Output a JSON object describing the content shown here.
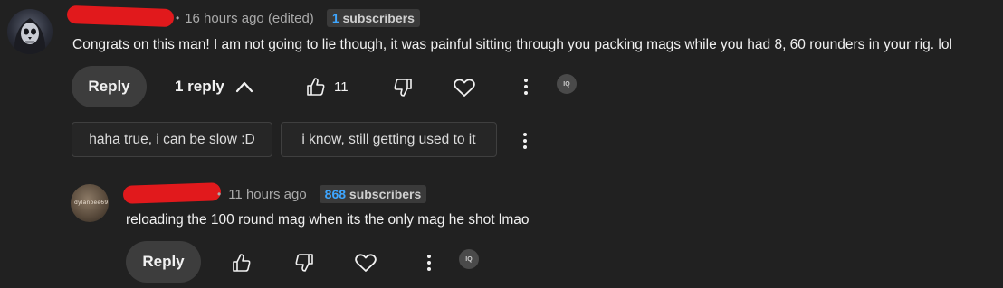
{
  "comment": {
    "avatar_icon": "skull-hooded-avatar-icon",
    "timestamp": "16 hours ago (edited)",
    "subscriber_count": "1",
    "subscriber_label": "subscribers",
    "text": "Congrats on this man! I am not going to lie though, it was painful sitting through you packing mags while you had 8, 60 rounders in your rig. lol",
    "actions": {
      "reply_label": "Reply",
      "replies_label": "1 reply",
      "like_count": "11"
    },
    "suggestions": [
      "haha true, i can be slow :D",
      "i know, still getting used to it"
    ],
    "extension_badge": "IQ"
  },
  "reply": {
    "avatar_text": "dylanbee69",
    "timestamp": "11 hours ago",
    "subscriber_count": "868",
    "subscriber_label": "subscribers",
    "text": "reloading the 100 round mag when its the only mag he shot lmao",
    "actions": {
      "reply_label": "Reply"
    },
    "extension_badge": "IQ"
  },
  "colors": {
    "background": "#212121",
    "redaction": "#e1191c",
    "accent": "#3ea6ff",
    "button_bg": "#3d3d3d"
  }
}
